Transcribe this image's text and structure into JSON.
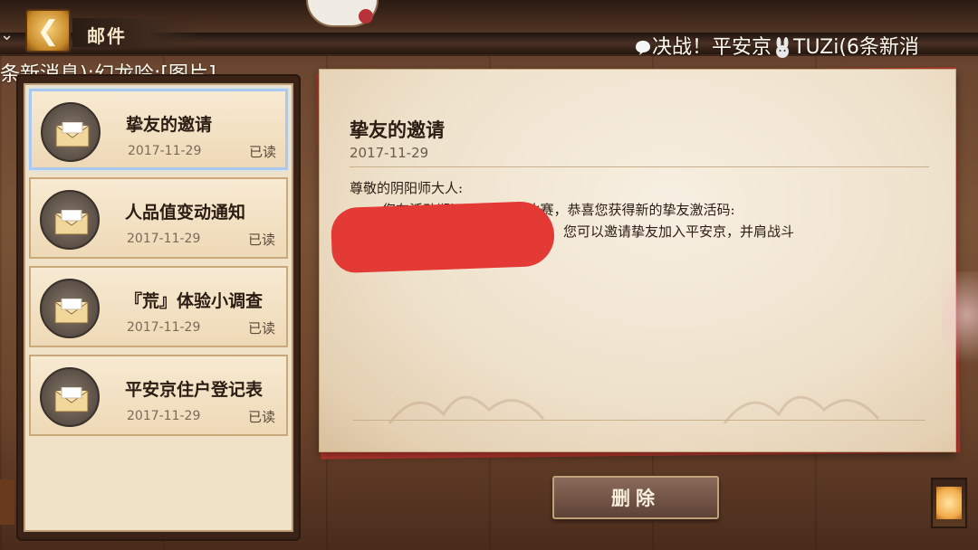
{
  "header": {
    "back_icon": "chevron-left-icon",
    "title": "邮件"
  },
  "chat": {
    "line1": "决战！平安京",
    "line1_suffix": "TUZi(6条新消",
    "line2": "条新消息):幻龙吟:[图片]"
  },
  "mail_list": [
    {
      "title": "挚友的邀请",
      "date": "2017-11-29",
      "status": "已读",
      "selected": true
    },
    {
      "title": "人品值变动通知",
      "date": "2017-11-29",
      "status": "已读",
      "selected": false
    },
    {
      "title": "『荒』体验小调查",
      "date": "2017-11-29",
      "status": "已读",
      "selected": false
    },
    {
      "title": "平安京住户登记表",
      "date": "2017-11-29",
      "status": "已读",
      "selected": false
    }
  ],
  "letter": {
    "title": "挚友的邀请",
    "date": "2017-11-29",
    "greeting": "尊敬的阴阳师大人:",
    "line2": "您在活动期间已完成6场比赛，恭喜您获得新的挚友激活码:",
    "line3": "您可以邀请挚友加入平安京，并肩战斗"
  },
  "actions": {
    "delete_label": "删除"
  },
  "colors": {
    "redaction": "#e33a36",
    "selected_border": "#a9c9f2",
    "letter_accent": "#b8372f"
  }
}
